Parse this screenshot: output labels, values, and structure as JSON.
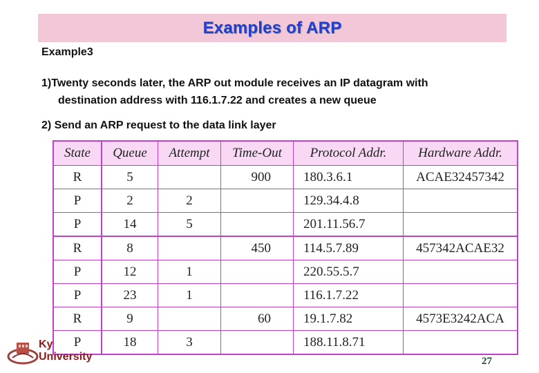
{
  "title": "Examples of ARP",
  "example_label": "Example3",
  "steps": {
    "step1_line1": "1)Twenty seconds later, the ARP out module receives an IP datagram with",
    "step1_line2": "destination address with 116.1.7.22 and creates a new queue",
    "step2": "2) Send an ARP request to the data link layer"
  },
  "table": {
    "headers": [
      "State",
      "Queue",
      "Attempt",
      "Time-Out",
      "Protocol Addr.",
      "Hardware Addr."
    ],
    "rows": [
      [
        "R",
        "5",
        "",
        "900",
        "180.3.6.1",
        "ACAE32457342"
      ],
      [
        "P",
        "2",
        "2",
        "",
        "129.34.4.8",
        ""
      ],
      [
        "P",
        "14",
        "5",
        "",
        "201.11.56.7",
        ""
      ],
      [
        "R",
        "8",
        "",
        "450",
        "114.5.7.89",
        "457342ACAE32"
      ],
      [
        "P",
        "12",
        "1",
        "",
        "220.55.5.7",
        ""
      ],
      [
        "P",
        "23",
        "1",
        "",
        "116.1.7.22",
        ""
      ],
      [
        "R",
        "9",
        "",
        "60",
        "19.1.7.82",
        "4573E3242ACA"
      ],
      [
        "P",
        "18",
        "3",
        "",
        "188.11.8.71",
        ""
      ]
    ]
  },
  "footer": {
    "university_line1": "Ky",
    "university_line2": "University",
    "page_number": "27"
  },
  "colors": {
    "title_bg": "#f2c8d9",
    "title_text": "#1f3fd0",
    "table_border": "#c040c8",
    "header_bg": "#f8d8f4"
  }
}
